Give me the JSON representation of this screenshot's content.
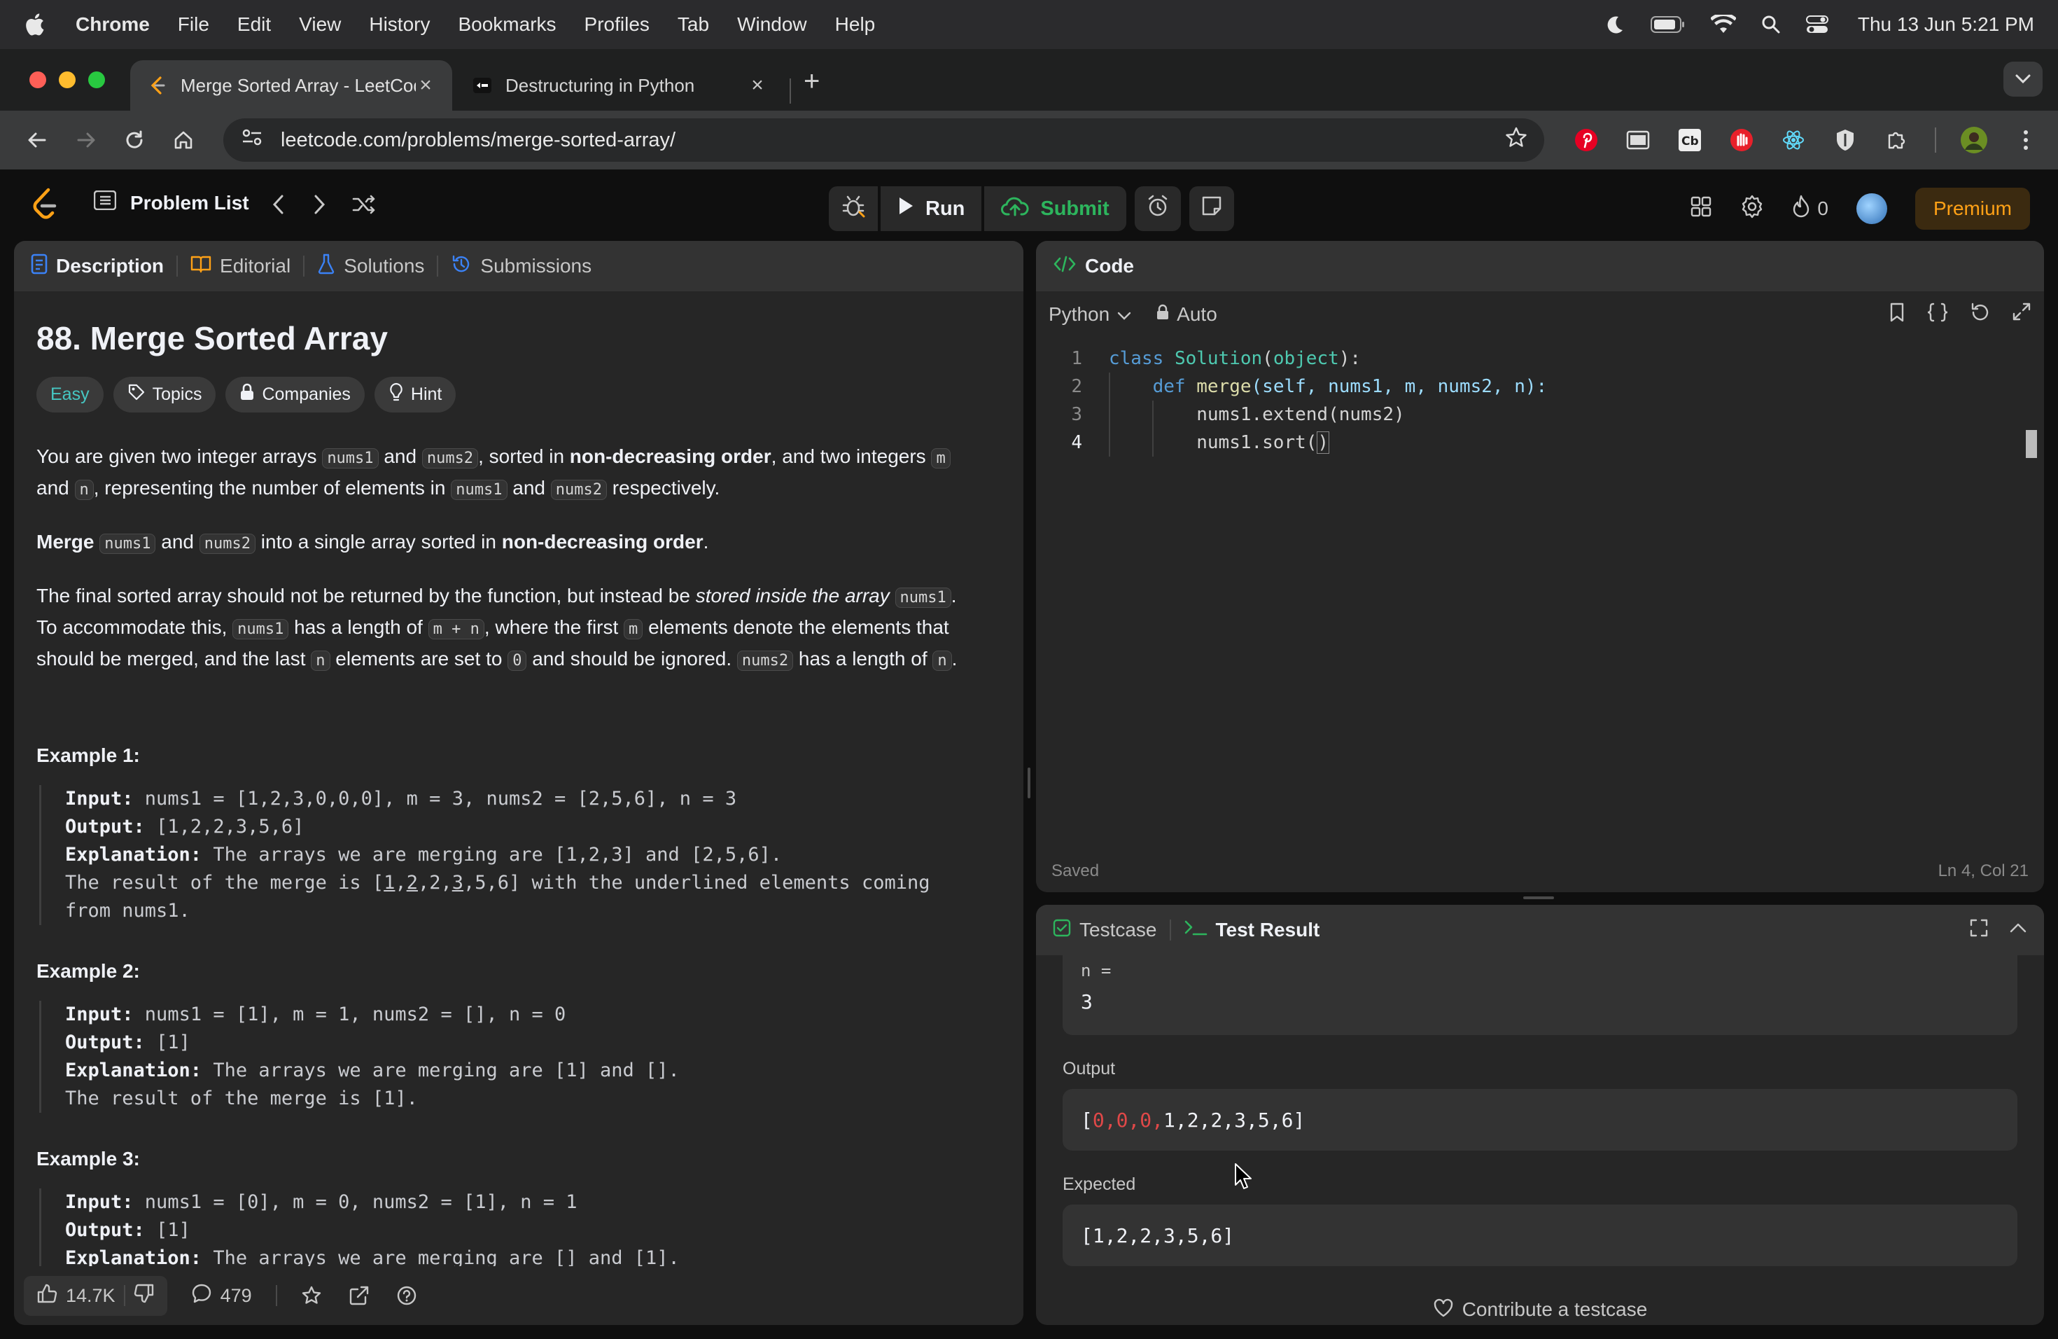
{
  "menubar": {
    "app": "Chrome",
    "items": [
      "File",
      "Edit",
      "View",
      "History",
      "Bookmarks",
      "Profiles",
      "Tab",
      "Window",
      "Help"
    ],
    "clock": "Thu 13 Jun  5:21 PM"
  },
  "tabs": [
    {
      "title": "Merge Sorted Array - LeetCode",
      "icon": "leetcode-icon",
      "active": true
    },
    {
      "title": "Destructuring in Python",
      "icon": "site-icon",
      "active": false
    }
  ],
  "toolbar": {
    "url": "leetcode.com/problems/merge-sorted-array/"
  },
  "lcnav": {
    "problem_list": "Problem List",
    "run": "Run",
    "submit": "Submit",
    "streak": "0",
    "premium": "Premium"
  },
  "left_tabs": [
    "Description",
    "Editorial",
    "Solutions",
    "Submissions"
  ],
  "problem": {
    "title": "88. Merge Sorted Array",
    "difficulty": "Easy",
    "tags": [
      "Topics",
      "Companies",
      "Hint"
    ],
    "p1": {
      "a": "You are given two integer arrays ",
      "c1": "nums1",
      "b": " and ",
      "c2": "nums2",
      "c": ", sorted in ",
      "bold1": "non-decreasing order",
      "d": ", and two integers ",
      "c3": "m",
      "e": "and ",
      "c4": "n",
      "f": ", representing the number of elements in ",
      "c5": "nums1",
      "g": " and ",
      "c6": "nums2",
      "h": " respectively."
    },
    "p2": {
      "bold": "Merge",
      "c1": "nums1",
      "a": " and ",
      "c2": "nums2",
      "b": " into a single array sorted in ",
      "bold2": "non-decreasing order",
      "c": "."
    },
    "p3": {
      "a": "The final sorted array should not be returned by the function, but instead be ",
      "ital": "stored inside the array",
      "c1": "nums1",
      "b": ".",
      "d": "To accommodate this, ",
      "c2": "nums1",
      "e": " has a length of ",
      "c3": "m + n",
      "f": ", where the first ",
      "c4": "m",
      "g": " elements denote the elements that",
      "h": "should be merged, and the last ",
      "c5": "n",
      "i": " elements are set to ",
      "c6": "0",
      "j": " and should be ignored. ",
      "c7": "nums2",
      "k": " has a length of ",
      "c8": "n",
      "l": "."
    },
    "examples": [
      {
        "heading": "Example 1:",
        "input_label": "Input:",
        "input": " nums1 = [1,2,3,0,0,0], m = 3, nums2 = [2,5,6], n = 3",
        "output_label": "Output:",
        "output": " [1,2,2,3,5,6]",
        "expl_label": "Explanation:",
        "expl": " The arrays we are merging are [1,2,3] and [2,5,6].",
        "expl2": "The result of the merge is [",
        "u1": "1",
        "s1": ",",
        "u2": "2",
        "s2": ",2,",
        "u3": "3",
        "s3": ",5,6] with the underlined elements coming",
        "expl3": "from nums1."
      },
      {
        "heading": "Example 2:",
        "input_label": "Input:",
        "input": " nums1 = [1], m = 1, nums2 = [], n = 0",
        "output_label": "Output:",
        "output": " [1]",
        "expl_label": "Explanation:",
        "expl": " The arrays we are merging are [1] and [].",
        "expl2": "The result of the merge is [1]."
      },
      {
        "heading": "Example 3:",
        "input_label": "Input:",
        "input": " nums1 = [0], m = 0, nums2 = [1], n = 1",
        "output_label": "Output:",
        "output": " [1]",
        "expl_label": "Explanation:",
        "expl": " The arrays we are merging are [] and [1]."
      }
    ]
  },
  "desc_footer": {
    "likes": "14.7K",
    "comments": "479"
  },
  "editor": {
    "title": "Code",
    "language": "Python",
    "mode": "Auto",
    "lines": [
      "1",
      "2",
      "3",
      "4"
    ],
    "code": {
      "l1_kw": "class",
      "l1_cls": "Solution",
      "l1_rest": "(",
      "l1_base": "object",
      "l1_end": "):",
      "l2_kw": "def",
      "l2_fn": "merge",
      "l2_rest": "(self, nums1, m, nums2, n):",
      "l3": "nums1.extend(nums2)",
      "l4_a": "nums1.sort(",
      "l4_b": ")"
    },
    "status": "Saved",
    "position": "Ln 4, Col 21"
  },
  "result": {
    "tab1": "Testcase",
    "tab2": "Test Result",
    "n_label": "n =",
    "n_value": "3",
    "output_label": "Output",
    "output_open": "[",
    "output_wrong": "0,0,0,",
    "output_rest": "1,2,2,3,5,6]",
    "expected_label": "Expected",
    "expected": "[1,2,2,3,5,6]",
    "contribute": "Contribute a testcase"
  },
  "colors": {
    "accent_orange": "#ffa116",
    "submit_green": "#2db55d",
    "easy_teal": "#46c6c2",
    "error_red": "#e04848"
  }
}
